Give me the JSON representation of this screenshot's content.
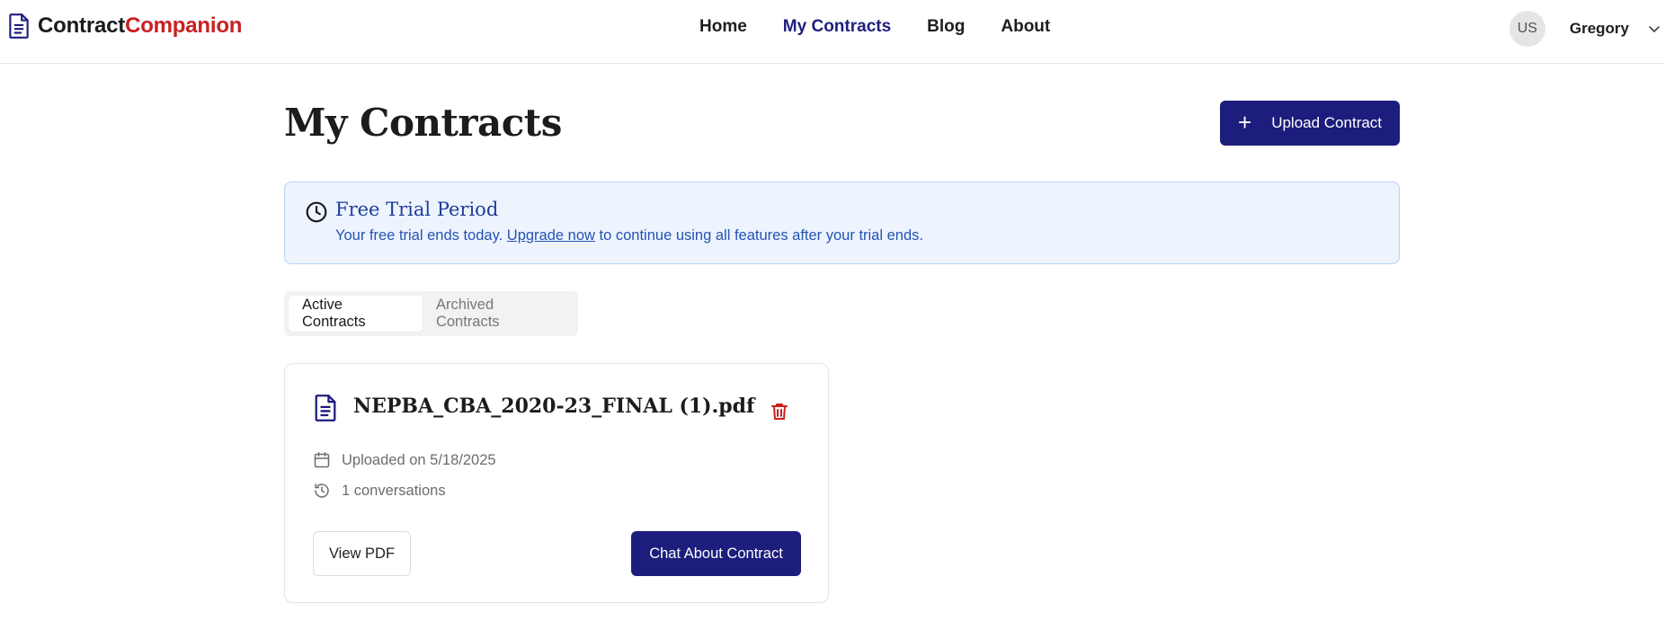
{
  "brand": {
    "name_part1": "Contract",
    "name_part2": "Companion",
    "accent": "#c8201f",
    "primary": "#1d1d7d"
  },
  "nav": {
    "items": [
      {
        "label": "Home",
        "active": false
      },
      {
        "label": "My Contracts",
        "active": true
      },
      {
        "label": "Blog",
        "active": false
      },
      {
        "label": "About",
        "active": false
      }
    ]
  },
  "user": {
    "initials": "US",
    "name": "Gregory"
  },
  "page": {
    "title": "My Contracts",
    "upload_label": "Upload Contract"
  },
  "banner": {
    "title": "Free Trial Period",
    "text_before": "Your free trial ends today. ",
    "link": "Upgrade now",
    "text_after": " to continue using all features after your trial ends."
  },
  "tabs": [
    {
      "label": "Active Contracts",
      "active": true
    },
    {
      "label": "Archived Contracts",
      "active": false
    }
  ],
  "contract": {
    "file_name": "NEPBA_CBA_2020-23_FINAL (1).pdf",
    "uploaded": "Uploaded on 5/18/2025",
    "conversations": "1 conversations",
    "view_label": "View PDF",
    "chat_label": "Chat About Contract"
  },
  "icons": {
    "logo": "document-icon",
    "banner": "clock-icon",
    "file": "file-text-icon",
    "delete": "trash-icon",
    "date": "calendar-icon",
    "history": "history-icon",
    "menu": "chevron-down-icon"
  }
}
